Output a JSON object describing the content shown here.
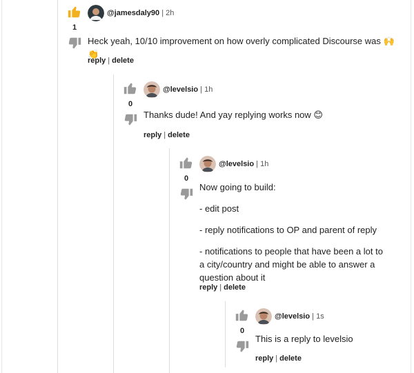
{
  "labels": {
    "reply": "reply",
    "delete": "delete",
    "separator": "|"
  },
  "comments": [
    {
      "votes": "1",
      "thumbs_up_active": true,
      "handle": "@jamesdaly90",
      "time": "| 2h",
      "paragraphs": [
        "Heck yeah, 10/10 improvement on how overly complicated Discourse was 🙌 👏"
      ]
    },
    {
      "votes": "0",
      "thumbs_up_active": false,
      "handle": "@levelsio",
      "time": "| 1h",
      "paragraphs": [
        "Thanks dude! And yay replying works now 😊"
      ]
    },
    {
      "votes": "0",
      "thumbs_up_active": false,
      "handle": "@levelsio",
      "time": "| 1h",
      "paragraphs": [
        "Now going to build:",
        "- edit post",
        "- reply notifications to OP and parent of reply",
        "- notifications to people that have been a lot to a city/country and might be able to answer a question about it"
      ]
    },
    {
      "votes": "0",
      "thumbs_up_active": false,
      "handle": "@levelsio",
      "time": "| 1s",
      "paragraphs": [
        "This is a reply to levelsio"
      ]
    }
  ],
  "colors": {
    "thumb_active": "#f2b01e",
    "thumb_inactive": "#9a9a9a",
    "thread_line": "#dcdcdc"
  },
  "icons": {
    "upvote": "thumbs-up-icon",
    "downvote": "thumbs-down-icon"
  }
}
